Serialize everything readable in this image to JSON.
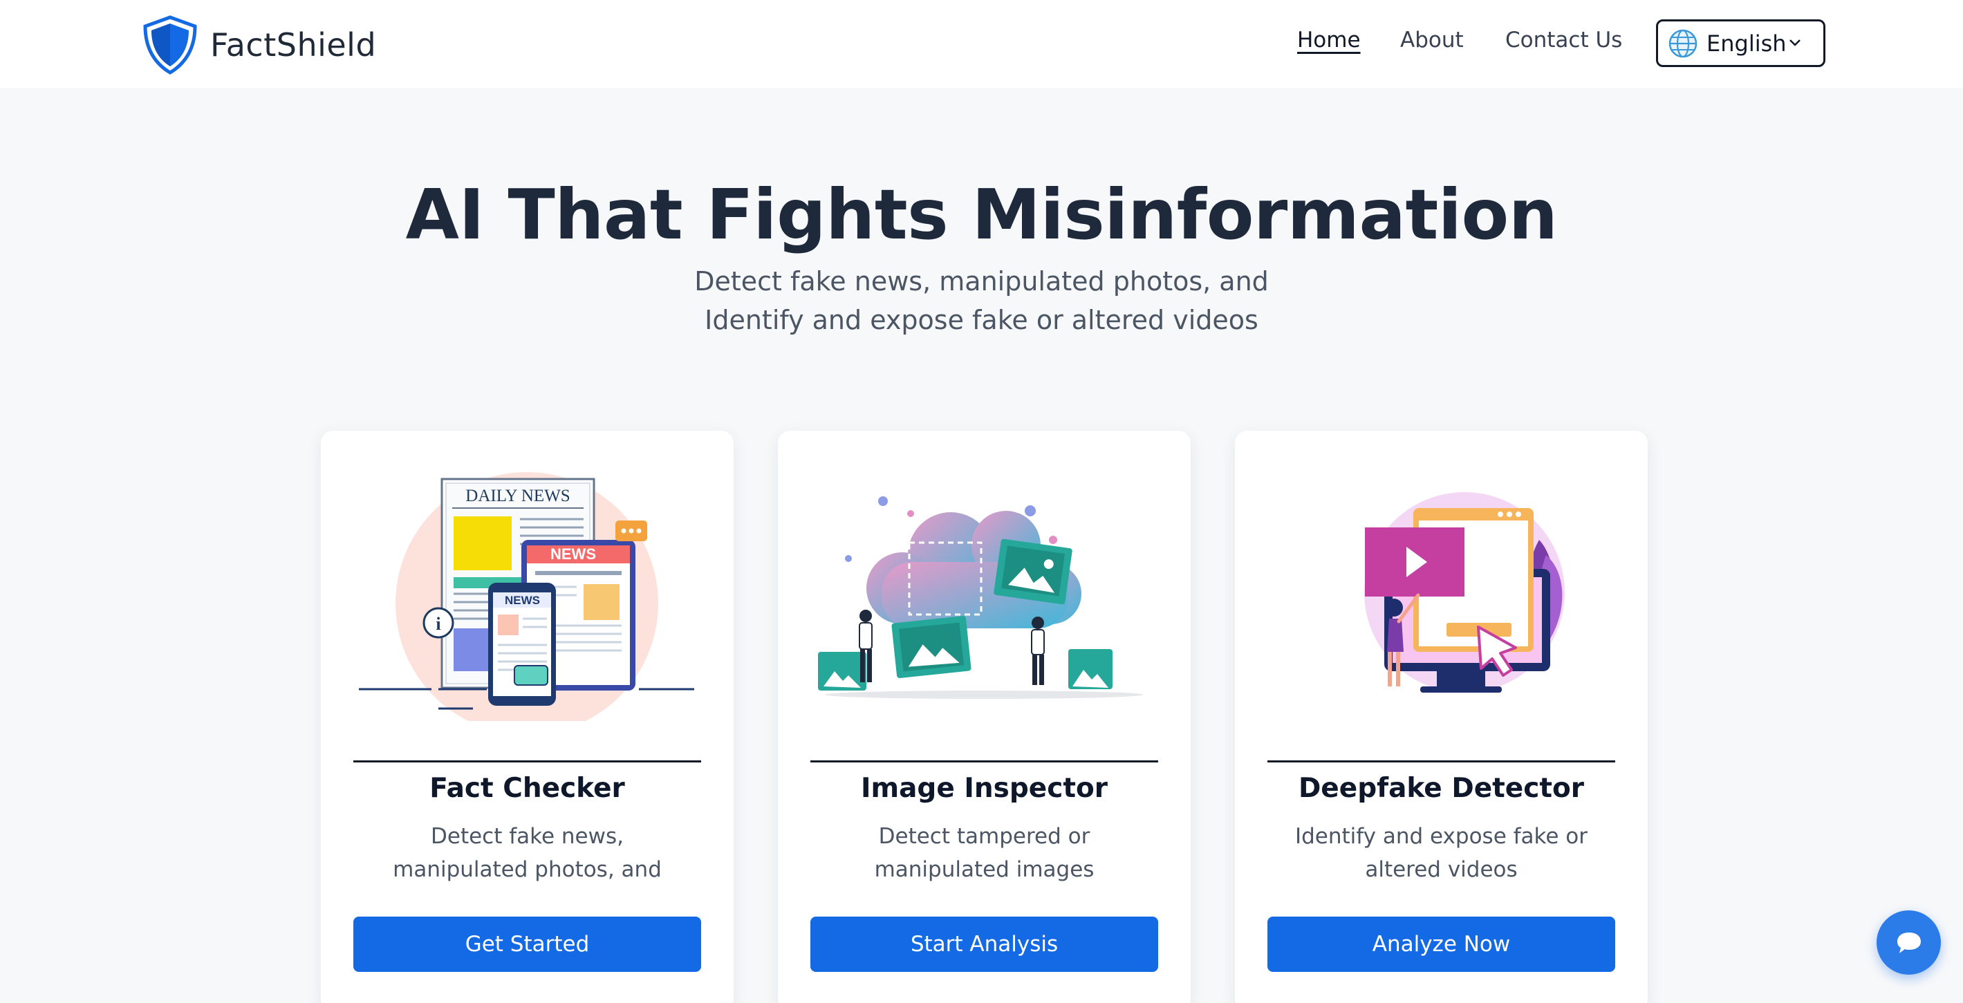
{
  "brand": {
    "name": "FactShield",
    "icon": "shield-icon",
    "color": "#1469e4"
  },
  "nav": {
    "links": [
      {
        "label": "Home",
        "active": true
      },
      {
        "label": "About",
        "active": false
      },
      {
        "label": "Contact Us",
        "active": false
      }
    ],
    "language": {
      "selected": "English",
      "icon": "globe-icon"
    }
  },
  "hero": {
    "title": "AI That Fights Misinformation",
    "subtitle_lines": [
      "Detect fake news, manipulated photos, and",
      "Identify and expose fake or altered videos"
    ]
  },
  "cards": [
    {
      "title": "Fact Checker",
      "description": "Detect fake news, manipulated photos, and",
      "button": "Get Started",
      "illustration": {
        "icon": "news-illustration",
        "labels": [
          "DAILY NEWS",
          "NEWS",
          "NEWS"
        ]
      }
    },
    {
      "title": "Image Inspector",
      "description": "Detect tampered or manipulated images",
      "button": "Start Analysis",
      "illustration": {
        "icon": "image-inspection-illustration"
      }
    },
    {
      "title": "Deepfake Detector",
      "description": "Identify and expose fake or altered videos",
      "button": "Analyze Now",
      "illustration": {
        "icon": "video-detection-illustration"
      }
    }
  ],
  "chat": {
    "icon": "chat-bubble-icon"
  },
  "colors": {
    "primary": "#1469e4",
    "background": "#f7f8fa",
    "heading": "#1e293b",
    "muted": "#4b5563"
  }
}
